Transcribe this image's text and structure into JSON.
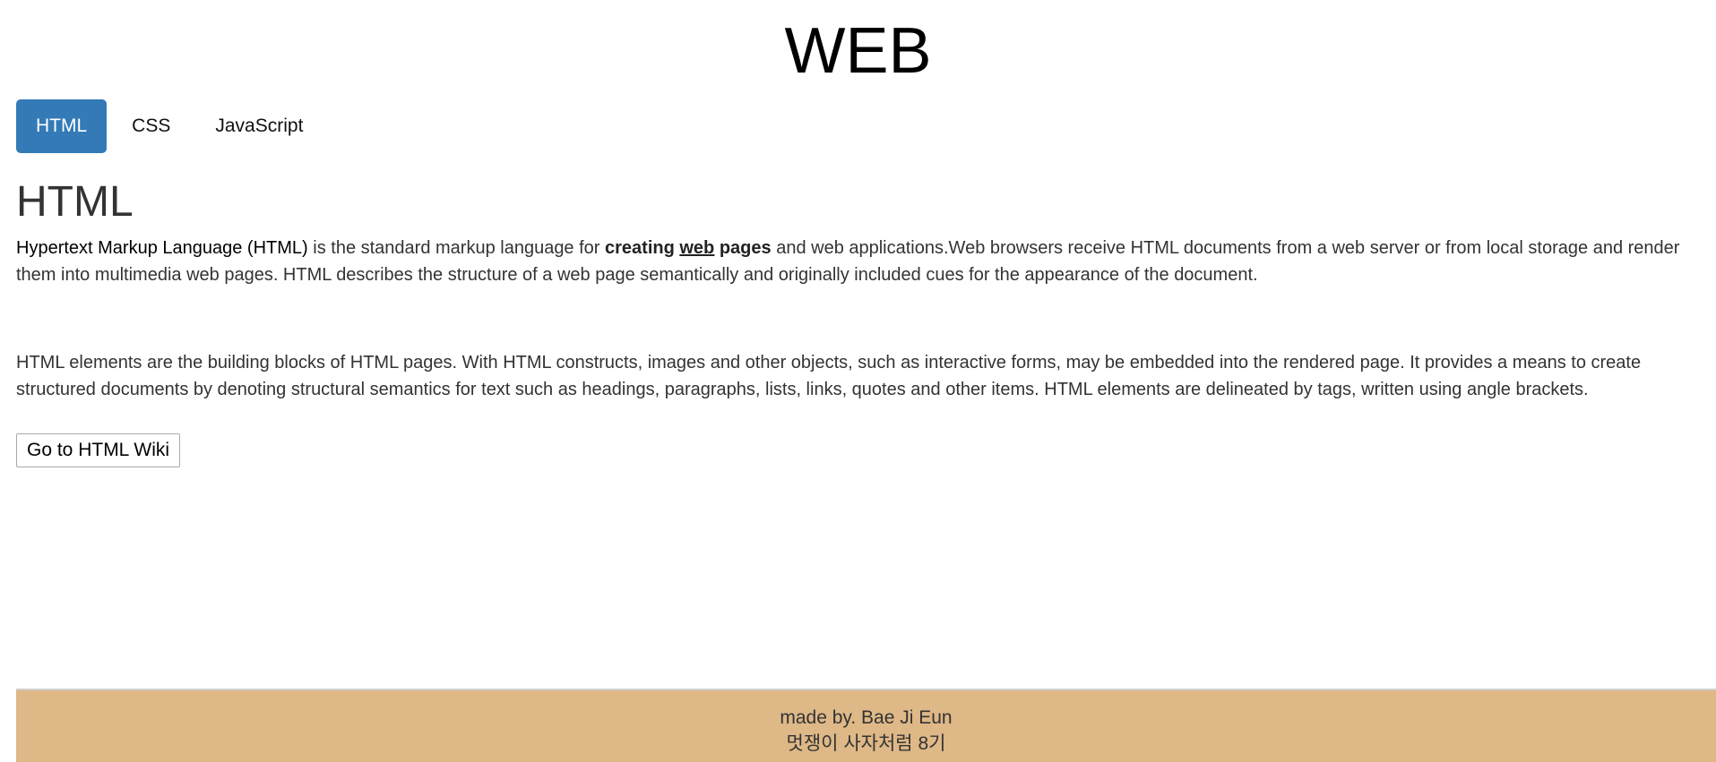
{
  "site": {
    "title": "WEB"
  },
  "tabs": [
    {
      "label": "HTML",
      "active": true
    },
    {
      "label": "CSS",
      "active": false
    },
    {
      "label": "JavaScript",
      "active": false
    }
  ],
  "article": {
    "heading": "HTML",
    "p1": {
      "lead": "Hypertext Markup Language (HTML)",
      "t1": " is the standard markup language for ",
      "b1": "creating ",
      "b2": "web",
      "b3": " pages",
      "t2": " and web applications.Web browsers receive HTML documents from a web server or from local storage and render them into multimedia web pages. HTML describes the structure of a web page semantically and originally included cues for the appearance of the document."
    },
    "p2": "HTML elements are the building blocks of HTML pages. With HTML constructs, images and other objects, such as interactive forms, may be embedded into the rendered page. It provides a means to create structured documents by denoting structural semantics for text such as headings, paragraphs, lists, links, quotes and other items. HTML elements are delineated by tags, written using angle brackets.",
    "button_label": "Go to HTML Wiki"
  },
  "footer": {
    "line1": "made by. Bae Ji Eun",
    "line2": "멋쟁이 사자처럼 8기"
  },
  "colors": {
    "active_tab": "#337ab7",
    "footer_bg": "#deb887"
  }
}
